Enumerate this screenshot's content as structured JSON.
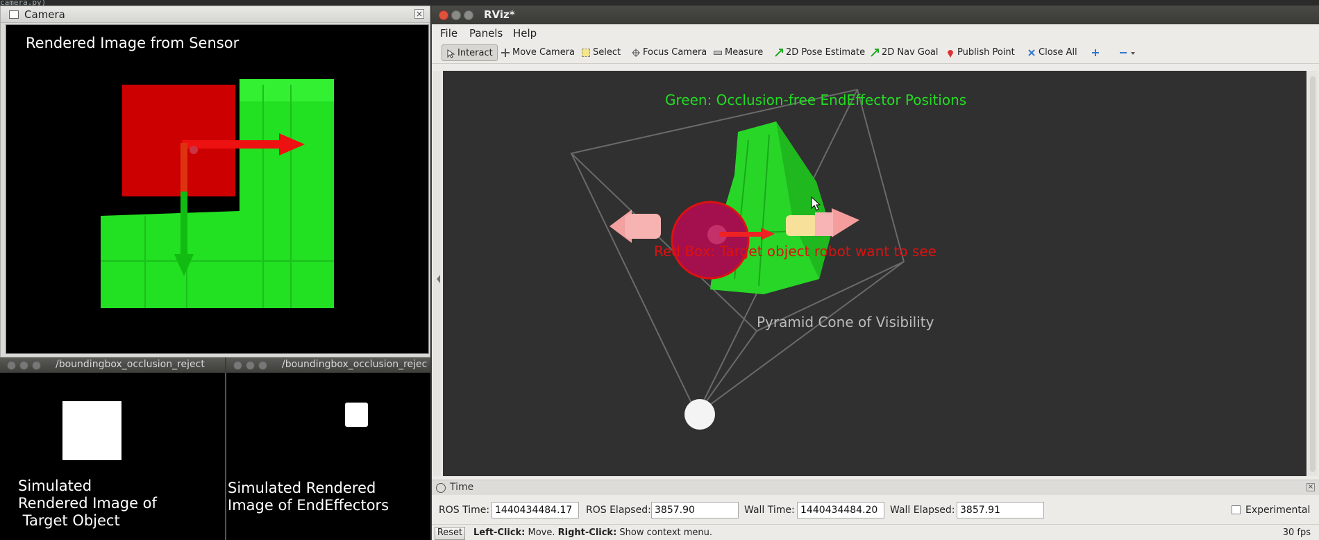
{
  "top_strip": {
    "text": "camera.py)"
  },
  "camera_window": {
    "title": "Camera",
    "overlay_label": "Rendered Image from Sensor"
  },
  "bbox_window_1": {
    "title": "/boundingbox_occlusion_reject",
    "label_lines": [
      "Simulated",
      "Rendered Image of",
      " Target Object"
    ]
  },
  "bbox_window_2": {
    "title": "/boundingbox_occlusion_reject",
    "label_lines": [
      "Simulated Rendered",
      "Image of EndEffectors"
    ]
  },
  "rviz": {
    "title": "RViz*",
    "menu": [
      "File",
      "Panels",
      "Help"
    ],
    "tools": [
      {
        "label": "Interact",
        "icon": "cursor-icon"
      },
      {
        "label": "Move Camera",
        "icon": "move-camera-icon"
      },
      {
        "label": "Select",
        "icon": "select-box-icon"
      },
      {
        "label": "Focus Camera",
        "icon": "crosshair-icon"
      },
      {
        "label": "Measure",
        "icon": "ruler-icon"
      },
      {
        "label": "2D Pose Estimate",
        "icon": "green-arrow-icon"
      },
      {
        "label": "2D Nav Goal",
        "icon": "green-arrow-icon"
      },
      {
        "label": "Publish Point",
        "icon": "map-pin-icon"
      },
      {
        "label": "Close All",
        "icon": "close-all-icon"
      }
    ],
    "viewport_labels": {
      "green": "Green: Occlusion-free EndEffector Positions",
      "red": "Red Box: Target object robot want to see",
      "cone": "Pyramid Cone of Visibility"
    },
    "time_panel": {
      "title": "Time",
      "ros_time_label": "ROS Time:",
      "ros_time": "1440434484.17",
      "ros_elapsed_label": "ROS Elapsed:",
      "ros_elapsed": "3857.90",
      "wall_time_label": "Wall Time:",
      "wall_time": "1440434484.20",
      "wall_elapsed_label": "Wall Elapsed:",
      "wall_elapsed": "3857.91",
      "experimental_label": "Experimental"
    },
    "status": {
      "reset_label": "Reset",
      "hint_left_bold": "Left-Click:",
      "hint_left": " Move. ",
      "hint_right_bold": "Right-Click:",
      "hint_right": " Show context menu.",
      "fps": "30 fps"
    }
  },
  "colors": {
    "green_label": "#22dd22",
    "red_label": "#dd1111",
    "cone_label": "#bbbbbb",
    "rviz_viewport_bg": "#303030"
  }
}
